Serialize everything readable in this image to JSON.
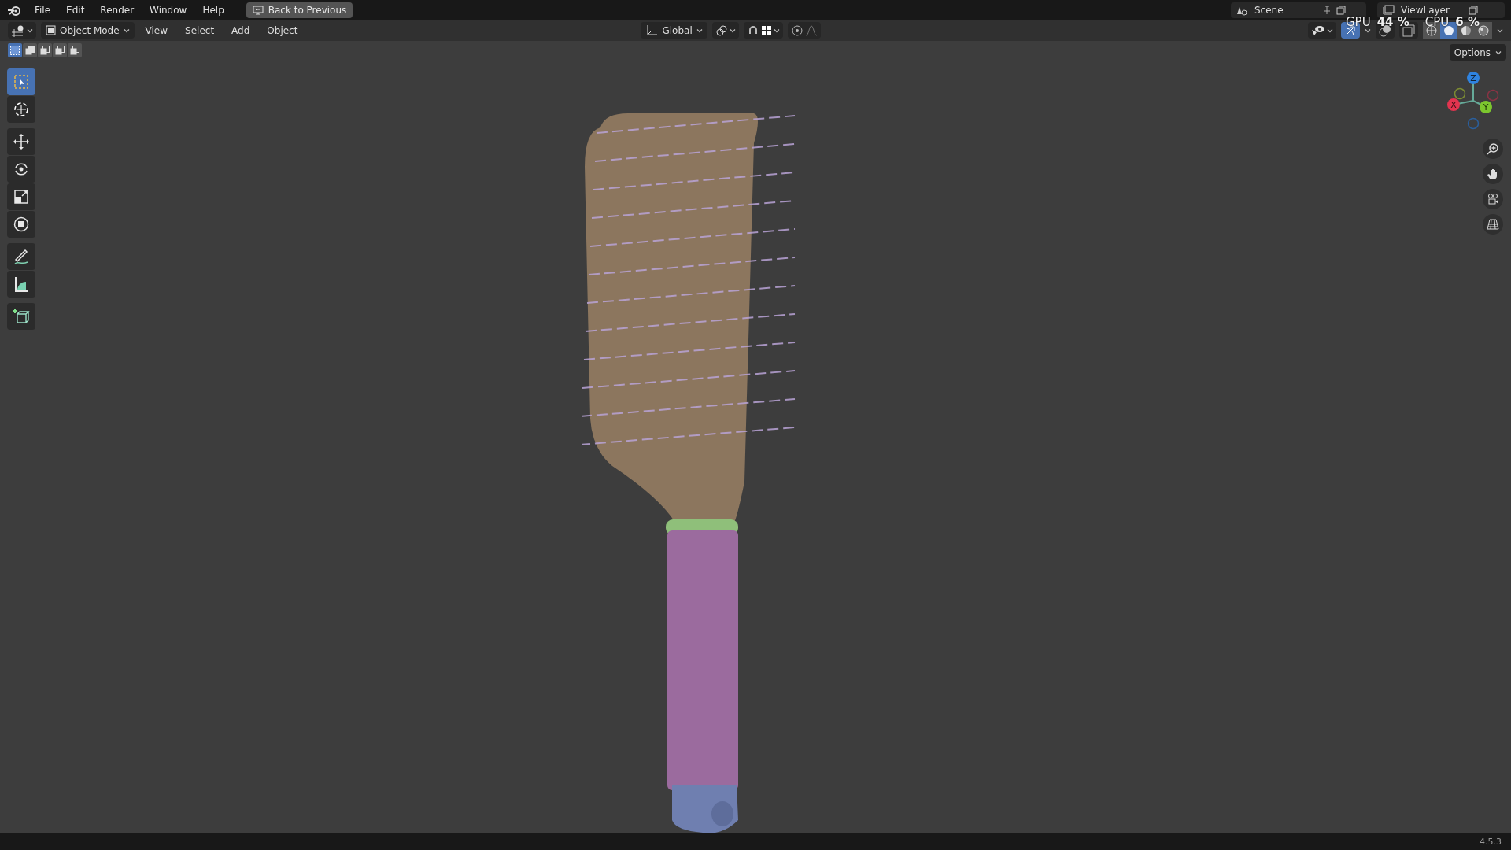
{
  "menu": [
    "File",
    "Edit",
    "Render",
    "Window",
    "Help"
  ],
  "back_button": "Back to Previous",
  "scene": "Scene",
  "view_layer": "ViewLayer",
  "stats": [
    {
      "label": "GPU",
      "value": "44 %"
    },
    {
      "label": "CPU",
      "value": "6 %"
    }
  ],
  "header": {
    "mode": "Object Mode",
    "menus": [
      "View",
      "Select",
      "Add",
      "Object"
    ],
    "orientation": "Global",
    "overlay_on": true,
    "options": "Options"
  },
  "select_modes": [
    {
      "selected": true
    },
    {
      "selected": false
    },
    {
      "selected": false
    },
    {
      "selected": false
    },
    {
      "selected": false
    }
  ],
  "shading": [
    {
      "kind": "wireframe",
      "selected": false
    },
    {
      "kind": "solid",
      "selected": true
    },
    {
      "kind": "material",
      "selected": false
    },
    {
      "kind": "rendered",
      "selected": false
    }
  ],
  "tools": [
    {
      "kind": "select",
      "selected": true
    },
    {
      "kind": "cursor",
      "selected": false
    },
    {
      "kind": "move",
      "selected": false
    },
    {
      "kind": "rotate",
      "selected": false
    },
    {
      "kind": "scale",
      "selected": false
    },
    {
      "kind": "transform",
      "selected": false
    },
    {
      "kind": "annotate",
      "selected": false
    },
    {
      "kind": "measure",
      "selected": false
    },
    {
      "kind": "add-cube",
      "selected": false
    }
  ],
  "gizmo": {
    "x": "X",
    "y": "Y",
    "z": "Z"
  },
  "version": "4.5.3"
}
